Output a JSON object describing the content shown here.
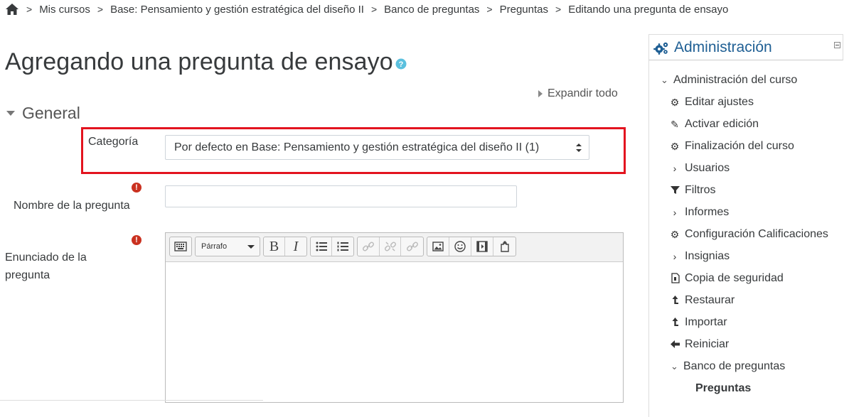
{
  "breadcrumb": {
    "items": [
      "Mis cursos",
      "Base: Pensamiento y gestión estratégica del diseño II",
      "Banco de preguntas",
      "Preguntas",
      "Editando una pregunta de ensayo"
    ],
    "separator": ">"
  },
  "page": {
    "title": "Agregando una pregunta de ensayo",
    "expand_all": "Expandir todo",
    "section": "General"
  },
  "form": {
    "category_label": "Categoría",
    "category_value": "Por defecto en Base: Pensamiento y gestión estratégica del diseño II (1)",
    "name_label": "Nombre de la pregunta",
    "name_value": "",
    "statement_label_line1": "Enunciado de la",
    "statement_label_line2": "pregunta",
    "required_mark": "!",
    "editor": {
      "paragraph_select": "Párrafo",
      "bold": "B",
      "italic": "I"
    }
  },
  "admin": {
    "title": "Administración",
    "items": [
      {
        "label": "Administración del curso",
        "icon": "chevron-down-icon"
      },
      {
        "label": "Editar ajustes",
        "icon": "gear-icon"
      },
      {
        "label": "Activar edición",
        "icon": "pencil-icon"
      },
      {
        "label": "Finalización del curso",
        "icon": "gear-icon"
      },
      {
        "label": "Usuarios",
        "icon": "chevron-right-icon"
      },
      {
        "label": "Filtros",
        "icon": "filter-icon"
      },
      {
        "label": "Informes",
        "icon": "chevron-right-icon"
      },
      {
        "label": "Configuración Calificaciones",
        "icon": "gear-icon"
      },
      {
        "label": "Insignias",
        "icon": "chevron-right-icon"
      },
      {
        "label": "Copia de seguridad",
        "icon": "file-icon"
      },
      {
        "label": "Restaurar",
        "icon": "upload-icon"
      },
      {
        "label": "Importar",
        "icon": "upload-icon"
      },
      {
        "label": "Reiniciar",
        "icon": "arrow-left-icon"
      },
      {
        "label": "Banco de preguntas",
        "icon": "chevron-down-icon"
      },
      {
        "label": "Preguntas",
        "icon": ""
      }
    ]
  },
  "colors": {
    "highlight": "#e3141f",
    "link_blue": "#1f5f94",
    "required": "#ca3120",
    "help": "#5bc0de"
  }
}
